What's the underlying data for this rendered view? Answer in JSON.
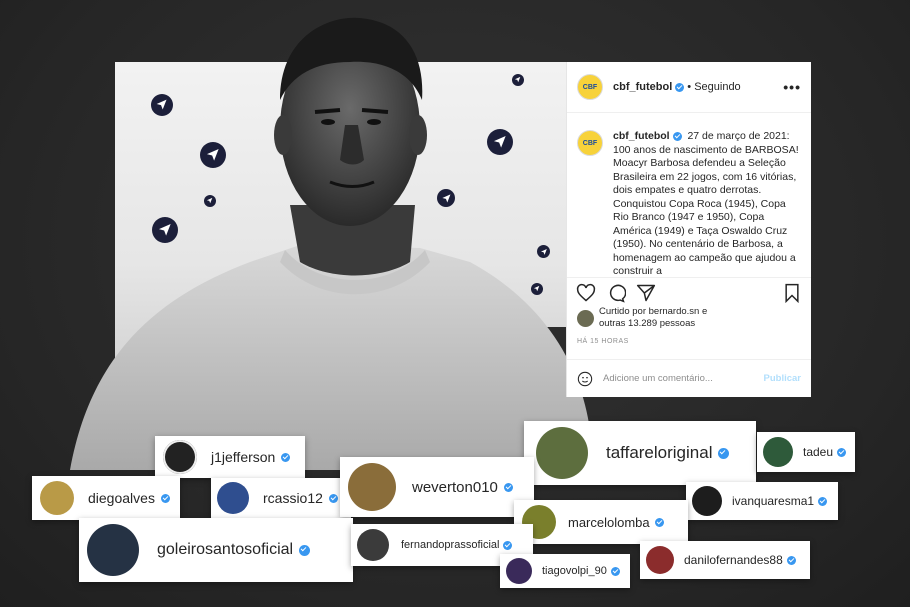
{
  "post": {
    "username": "cbf_futebol",
    "follow_label": "• Seguindo",
    "more_label": "•••",
    "avatar_text": "CBF",
    "caption_username": "cbf_futebol",
    "caption_text": "27 de março de 2021: 100 anos de nascimento de BARBOSA! Moacyr Barbosa defendeu a Seleção Brasileira em 22 jogos, com 16 vitórias, dois empates e quatro derrotas. Conquistou Copa Roca (1945), Copa Rio Branco (1947 e 1950), Copa América (1949) e Taça Oswaldo Cruz (1950). No centenário de Barbosa, a homenagem ao campeão que ajudou a construir a",
    "likes_line1": "Curtido por bernardo.sn e",
    "likes_line2": "outras 13.289 pessoas",
    "time": "HÁ 15 HORAS",
    "comment_placeholder": "Adicione um comentário...",
    "publish_label": "Publicar"
  },
  "tags": [
    {
      "username": "j1jefferson"
    },
    {
      "username": "taffareloriginal"
    },
    {
      "username": "tadeu"
    },
    {
      "username": "diegoalves"
    },
    {
      "username": "rcassio12"
    },
    {
      "username": "weverton010"
    },
    {
      "username": "ivanquaresma1"
    },
    {
      "username": "marcelolomba"
    },
    {
      "username": "goleirosantosoficial"
    },
    {
      "username": "fernandoprassoficial"
    },
    {
      "username": "danilofernandes88"
    },
    {
      "username": "tiagovolpi_90"
    }
  ],
  "colors": {
    "verified": "#3897f0",
    "plane_badge": "#1c1f3a",
    "background": "#2b2b2b",
    "publish": "#b2dffc"
  }
}
